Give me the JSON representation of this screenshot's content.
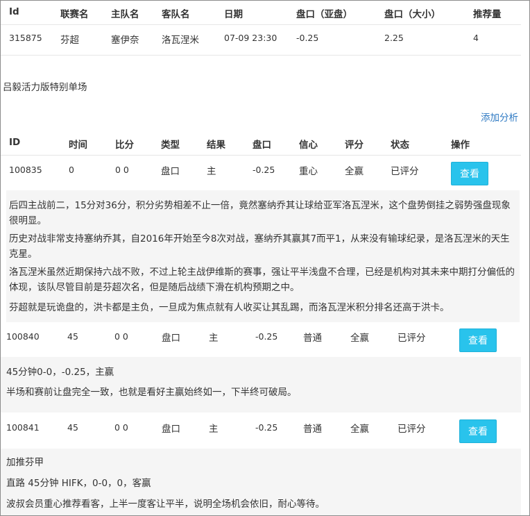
{
  "match_table": {
    "headers": [
      "Id",
      "联赛名",
      "主队名",
      "客队名",
      "日期",
      "盘口（亚盘）",
      "盘口（大小）",
      "推荐量"
    ],
    "row": [
      "315875",
      "芬超",
      "塞伊奈",
      "洛瓦涅米",
      "07-09 23:30",
      "-0.25",
      "2.25",
      "4"
    ]
  },
  "section_title": "吕毅活力版特别单场",
  "add_analysis_label": "添加分析",
  "analysis_table": {
    "headers": [
      "ID",
      "时间",
      "比分",
      "类型",
      "结果",
      "盘口",
      "信心",
      "评分",
      "状态",
      "操作"
    ],
    "rows": [
      {
        "cells": [
          "100835",
          "0",
          "0 0",
          "盘口",
          "主",
          "-0.25",
          "重心",
          "全赢",
          "已评分"
        ],
        "button": "查看",
        "notes": [
          "后四主战前二，15分对36分，积分劣势相差不止一倍，竟然塞纳乔其让球给亚军洛瓦涅米，这个盘势倒挂之弱势强盘现象很明显。",
          "历史对战非常支持塞纳乔其，自2016年开始至今8次对战，塞纳乔其赢其7而平1，从来没有输球纪录，是洛瓦涅米的天生克星。",
          "洛瓦涅米虽然近期保持六战不败，不过上轮主战伊维斯的赛事，强让平半浅盘不合理，已经是机构对其未来中期打分偏低的体现，该队尽管目前是芬超次名，但是随后战绩下滑在机构预期之中。",
          "芬超就是玩诡盘的，洪卡都是主负，一旦成为焦点就有人收买让其乱踢，而洛瓦涅米积分排名还高于洪卡。"
        ]
      },
      {
        "cells": [
          "100840",
          "45",
          "0 0",
          "盘口",
          "主",
          "-0.25",
          "普通",
          "全赢",
          "已评分"
        ],
        "button": "查看",
        "notes": [
          "45分钟0-0，-0.25，主赢",
          "半场和赛前让盘完全一致，也就是看好主赢始终如一，下半终可破局。"
        ]
      },
      {
        "cells": [
          "100841",
          "45",
          "0 0",
          "盘口",
          "主",
          "-0.25",
          "普通",
          "全赢",
          "已评分"
        ],
        "button": "查看",
        "notes": [
          "加推芬甲",
          "直路 45分钟 HIFK，0-0，0，客赢",
          "波叔会员重心推荐看客，上半一度客让平半，说明全场机会依旧，耐心等待。"
        ]
      }
    ]
  }
}
